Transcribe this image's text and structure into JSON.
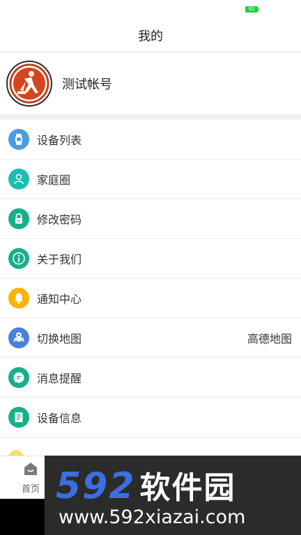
{
  "status_bar": {
    "battery": "91"
  },
  "header": {
    "title": "我的"
  },
  "profile": {
    "name": "测试帐号"
  },
  "menu": {
    "items": [
      {
        "label": "设备列表",
        "icon": "watch-icon",
        "color": "#4a9de0"
      },
      {
        "label": "家庭圈",
        "icon": "user-icon",
        "color": "#1bbcb2"
      },
      {
        "label": "修改密码",
        "icon": "lock-icon",
        "color": "#17b089"
      },
      {
        "label": "关于我们",
        "icon": "info-icon",
        "color": "#17b089"
      },
      {
        "label": "通知中心",
        "icon": "bell-icon",
        "color": "#f7b500"
      },
      {
        "label": "切换地图",
        "icon": "map-icon",
        "color": "#4a7fe0",
        "value": "高德地图"
      },
      {
        "label": "消息提醒",
        "icon": "chat-icon",
        "color": "#17b089"
      },
      {
        "label": "设备信息",
        "icon": "document-icon",
        "color": "#17b089"
      }
    ]
  },
  "bottom_nav": {
    "home_label": "首页"
  },
  "watermark": {
    "logo_num": "592",
    "logo_cn": "软件园",
    "url": "www.592xiazai.com"
  }
}
